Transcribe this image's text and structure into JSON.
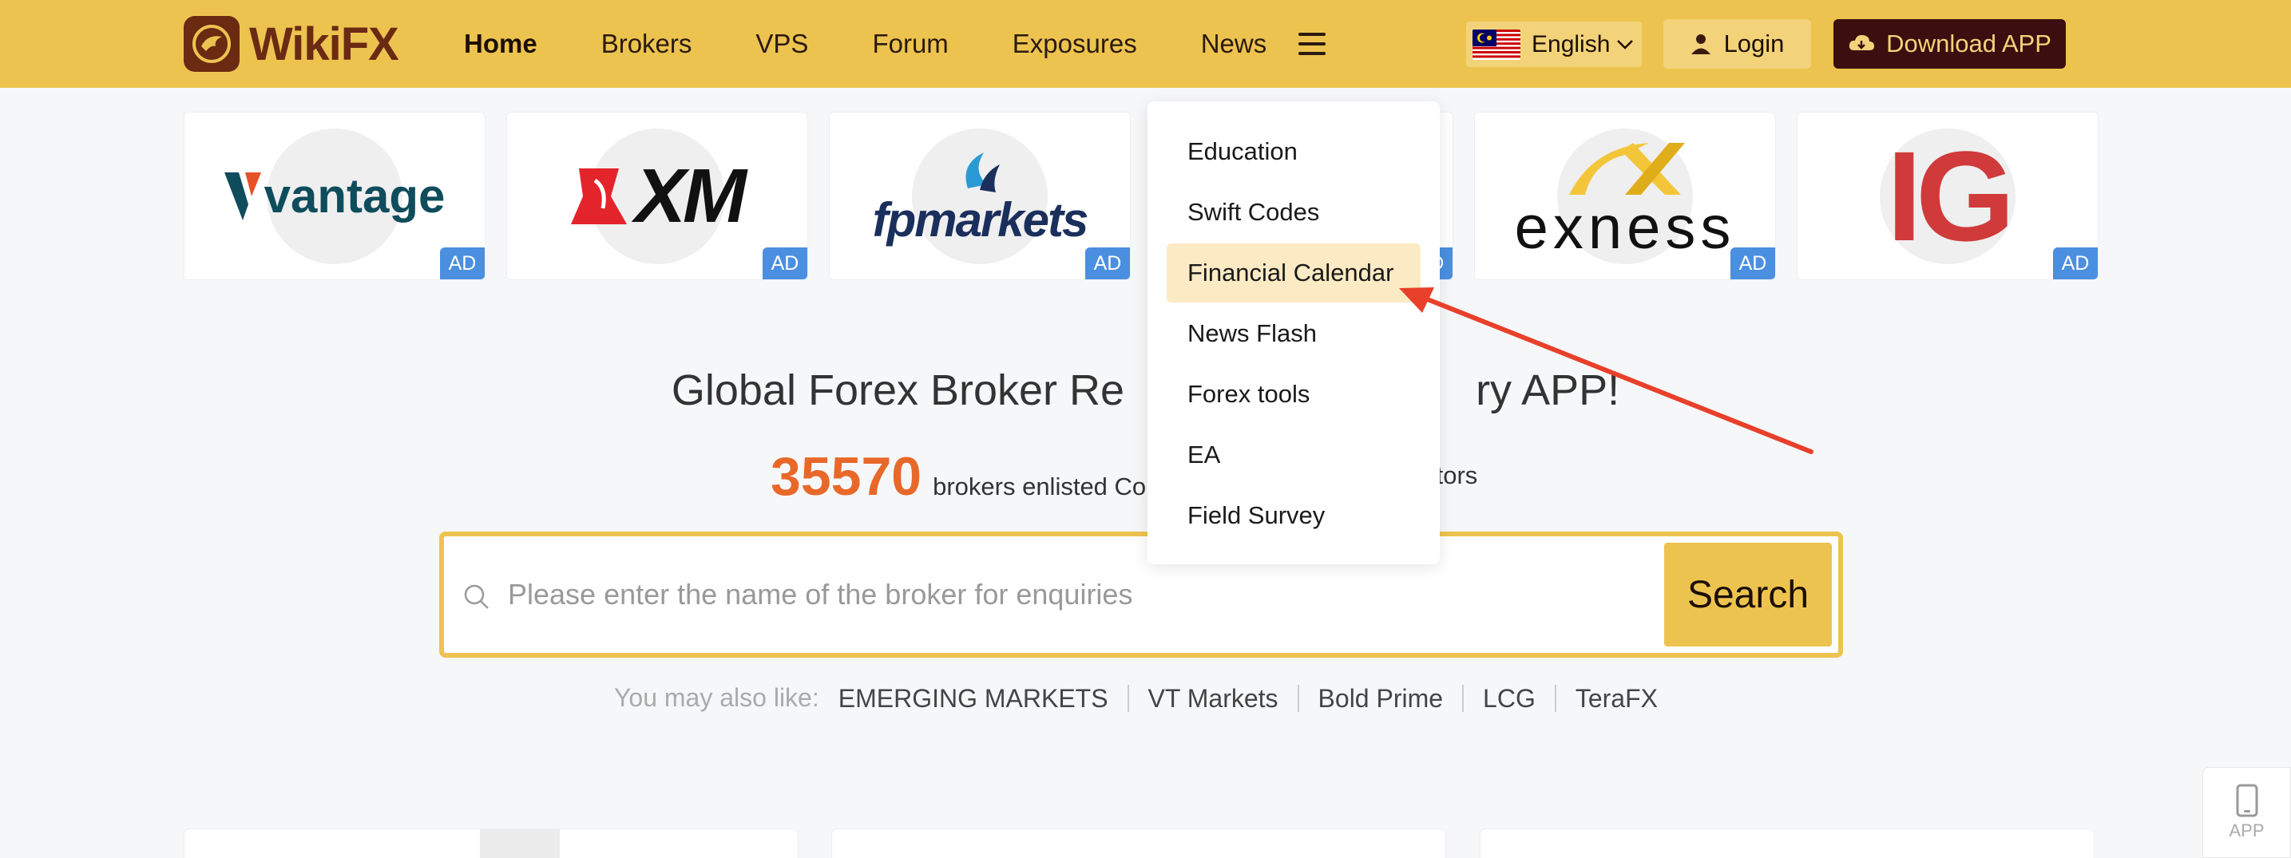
{
  "header": {
    "logo_text": "WikiFX",
    "nav": [
      {
        "label": "Home",
        "active": true
      },
      {
        "label": "Brokers",
        "active": false
      },
      {
        "label": "VPS",
        "active": false
      },
      {
        "label": "Forum",
        "active": false
      },
      {
        "label": "Exposures",
        "active": false
      },
      {
        "label": "News",
        "active": false
      }
    ],
    "language": "English",
    "login_label": "Login",
    "download_label": "Download APP"
  },
  "ads": [
    {
      "brand": "vantage",
      "badge": "AD"
    },
    {
      "brand": "XM",
      "badge": "AD"
    },
    {
      "brand": "fpmarkets",
      "badge": "AD"
    },
    {
      "brand": "",
      "badge": "AD"
    },
    {
      "brand": "exness",
      "badge": "AD"
    },
    {
      "brand": "IG",
      "badge": "AD"
    }
  ],
  "dropdown": {
    "items": [
      {
        "label": "Education"
      },
      {
        "label": "Swift Codes"
      },
      {
        "label": "Financial Calendar",
        "highlighted": true
      },
      {
        "label": "News Flash"
      },
      {
        "label": "Forex tools"
      },
      {
        "label": "EA"
      },
      {
        "label": "Field Survey"
      }
    ]
  },
  "hero": {
    "title_left": "Global Forex Broker Re",
    "title_right": "ry APP!",
    "count": "35570",
    "count_text": "brokers enlisted Co",
    "count_tail": "gulators"
  },
  "search": {
    "placeholder": "Please enter the name of the broker for enquiries",
    "button_label": "Search"
  },
  "suggestions": {
    "label": "You may also like:",
    "items": [
      "EMERGING MARKETS",
      "VT Markets",
      "Bold Prime",
      "LCG",
      "TeraFX"
    ]
  },
  "app_float_label": "APP",
  "colors": {
    "header_bg": "#edc34f",
    "accent_orange": "#e8682a",
    "badge_blue": "#4b8fe0",
    "arrow_red": "#e8402a"
  }
}
